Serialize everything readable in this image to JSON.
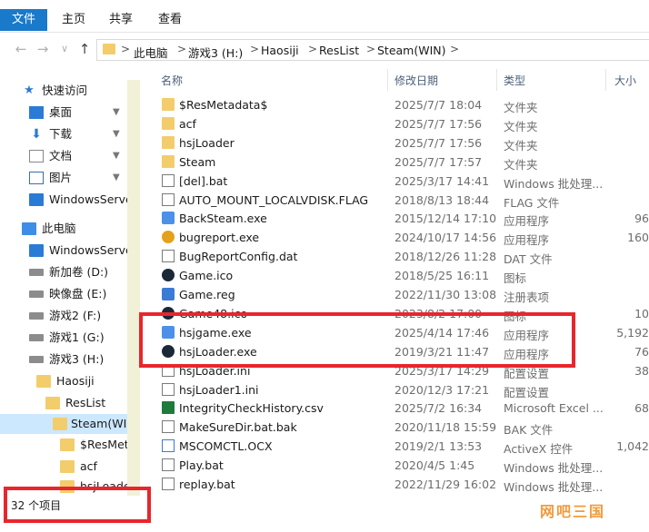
{
  "title_hint": "> Steam(WIN)",
  "ribbon": {
    "tabs": [
      "文件",
      "主页",
      "共享",
      "查看"
    ]
  },
  "nav": {
    "back": "←",
    "forward": "→",
    "recent": "∨",
    "up": "↑"
  },
  "address": {
    "crumbs": [
      "此电脑",
      "游戏3 (H:)",
      "Haosiji",
      "ResList",
      "Steam(WIN)"
    ],
    "separator": ">"
  },
  "sidebar": {
    "items": [
      {
        "label": "快速访问",
        "icon": "star-icon"
      },
      {
        "label": "桌面",
        "icon": "desktop-icon",
        "pinned": true
      },
      {
        "label": "下载",
        "icon": "download-icon",
        "pinned": true
      },
      {
        "label": "文档",
        "icon": "document-icon",
        "pinned": true
      },
      {
        "label": "图片",
        "icon": "picture-icon",
        "pinned": true
      },
      {
        "label": "WindowsServe",
        "icon": "network-icon"
      },
      {
        "label": "此电脑",
        "icon": "pc-icon"
      },
      {
        "label": "WindowsServe",
        "icon": "network-icon"
      },
      {
        "label": "新加卷 (D:)",
        "icon": "drive-icon"
      },
      {
        "label": "映像盘 (E:)",
        "icon": "drive-icon"
      },
      {
        "label": "游戏2 (F:)",
        "icon": "drive-icon"
      },
      {
        "label": "游戏1 (G:)",
        "icon": "drive-icon"
      },
      {
        "label": "游戏3 (H:)",
        "icon": "drive-icon"
      },
      {
        "label": "Haosiji",
        "icon": "folder-icon"
      },
      {
        "label": "ResList",
        "icon": "folder-icon"
      },
      {
        "label": "Steam(WIN",
        "icon": "folder-icon",
        "selected": true
      },
      {
        "label": "$ResMeta",
        "icon": "folder-icon"
      },
      {
        "label": "acf",
        "icon": "folder-icon"
      },
      {
        "label": "hsjLoade",
        "icon": "folder-icon"
      }
    ],
    "pin_glyph": "📌"
  },
  "status": {
    "count_text": "32 个项目"
  },
  "columns": {
    "name": "名称",
    "date": "修改日期",
    "type": "类型",
    "size": "大小"
  },
  "files": [
    {
      "name": "$ResMetadata$",
      "date": "2025/7/7 18:04",
      "type": "文件夹",
      "size": "",
      "icon": "folder-icon"
    },
    {
      "name": "acf",
      "date": "2025/7/7 17:56",
      "type": "文件夹",
      "size": "",
      "icon": "folder-icon"
    },
    {
      "name": "hsjLoader",
      "date": "2025/7/7 17:56",
      "type": "文件夹",
      "size": "",
      "icon": "folder-icon"
    },
    {
      "name": "Steam",
      "date": "2025/7/7 17:57",
      "type": "文件夹",
      "size": "",
      "icon": "folder-icon"
    },
    {
      "name": "[del].bat",
      "date": "2025/3/17 14:41",
      "type": "Windows 批处理...",
      "size": "",
      "icon": "batch-file-icon"
    },
    {
      "name": "AUTO_MOUNT_LOCALVDISK.FLAG",
      "date": "2018/8/13 18:44",
      "type": "FLAG 文件",
      "size": "",
      "icon": "file-icon"
    },
    {
      "name": "BackSteam.exe",
      "date": "2015/12/14 17:10",
      "type": "应用程序",
      "size": "96",
      "icon": "exe-icon"
    },
    {
      "name": "bugreport.exe",
      "date": "2024/10/17 14:56",
      "type": "应用程序",
      "size": "160",
      "icon": "bug-icon"
    },
    {
      "name": "BugReportConfig.dat",
      "date": "2018/12/26 11:28",
      "type": "DAT 文件",
      "size": "",
      "icon": "file-icon"
    },
    {
      "name": "Game.ico",
      "date": "2018/5/25 16:11",
      "type": "图标",
      "size": "",
      "icon": "steam-icon"
    },
    {
      "name": "Game.reg",
      "date": "2022/11/30 13:08",
      "type": "注册表项",
      "size": "",
      "icon": "registry-icon"
    },
    {
      "name": "Game48.ico",
      "date": "2023/8/2 17:00",
      "type": "图标",
      "size": "10",
      "icon": "steam-icon"
    },
    {
      "name": "hsjgame.exe",
      "date": "2025/4/14 17:46",
      "type": "应用程序",
      "size": "5,192",
      "icon": "exe-icon"
    },
    {
      "name": "hsjLoader.exe",
      "date": "2019/3/21 11:47",
      "type": "应用程序",
      "size": "76",
      "icon": "steam-icon"
    },
    {
      "name": "hsjLoader.ini",
      "date": "2025/3/17 14:29",
      "type": "配置设置",
      "size": "38",
      "icon": "ini-icon"
    },
    {
      "name": "hsjLoader1.ini",
      "date": "2020/12/3 17:21",
      "type": "配置设置",
      "size": "",
      "icon": "ini-icon"
    },
    {
      "name": "IntegrityCheckHistory.csv",
      "date": "2025/7/2 16:34",
      "type": "Microsoft Excel ...",
      "size": "68",
      "icon": "excel-icon"
    },
    {
      "name": "MakeSureDir.bat.bak",
      "date": "2020/11/18 15:59",
      "type": "BAK 文件",
      "size": "",
      "icon": "file-icon"
    },
    {
      "name": "MSCOMCTL.OCX",
      "date": "2019/2/1 13:53",
      "type": "ActiveX 控件",
      "size": "1,042",
      "icon": "ocx-icon"
    },
    {
      "name": "Play.bat",
      "date": "2020/4/5 1:45",
      "type": "Windows 批处理...",
      "size": "",
      "icon": "batch-file-icon"
    },
    {
      "name": "replay.bat",
      "date": "2022/11/29 16:02",
      "type": "Windows 批处理...",
      "size": "",
      "icon": "batch-file-icon"
    }
  ],
  "watermark": "网吧三国",
  "colors": {
    "accent": "#1979ca",
    "highlight_box": "#e8262c",
    "selected_bg": "#cce8ff",
    "folder": "#f3cd6b"
  }
}
